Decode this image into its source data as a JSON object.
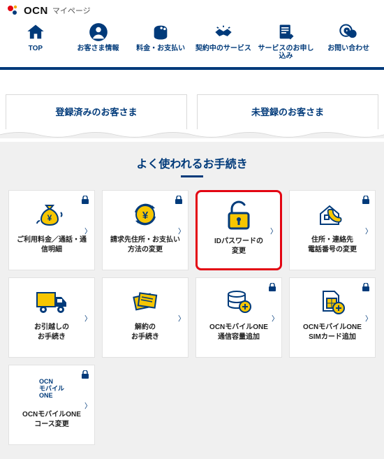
{
  "header": {
    "logo_text": "OCN",
    "page_label": "マイページ"
  },
  "nav": [
    {
      "label": "TOP"
    },
    {
      "label": "お客さま情報"
    },
    {
      "label": "料金・お支払い"
    },
    {
      "label": "契約中のサービス"
    },
    {
      "label": "サービスのお申し込み"
    },
    {
      "label": "お問い合わせ"
    }
  ],
  "tabs": {
    "registered": "登録済みのお客さま",
    "unregistered": "未登録のお客さま"
  },
  "procedures_title": "よく使われるお手続き",
  "cards": [
    {
      "title": "ご利用料金／通話・通\n信明細"
    },
    {
      "title": "請求先住所・お支払い\n方法の変更"
    },
    {
      "title": "IDパスワードの\n変更"
    },
    {
      "title": "住所・連絡先\n電話番号の変更"
    },
    {
      "title": "お引越しの\nお手続き"
    },
    {
      "title": "解約の\nお手続き"
    },
    {
      "title": "OCNモバイルONE\n通信容量追加"
    },
    {
      "title": "OCNモバイルONE\nSIMカード追加"
    },
    {
      "title": "OCNモバイルONE\nコース変更",
      "brand": "OCN\nモバイル\nONE"
    }
  ]
}
